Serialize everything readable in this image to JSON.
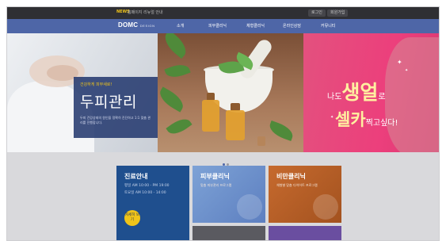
{
  "topbar": {
    "news_badge": "NEWS",
    "news_text": "홈페이지 리뉴얼 안내",
    "login_label": "로그인",
    "join_label": "회원가입"
  },
  "nav": {
    "logo": "DOMC",
    "logo_sub": "DESIGN",
    "items": [
      "소개",
      "피부클리닉",
      "체형클리닉",
      "온라인상담",
      "커뮤니티"
    ]
  },
  "hero": {
    "panel1": {
      "small": "건강하게 피부새로!",
      "big": "두피관리",
      "desc": "두피 건강상태의 원인을 정확히 진단하고 1:1 맞춤 관리를 진행합니다."
    },
    "panel3": {
      "line1_pre": "나도",
      "line1_big": "생얼",
      "line1_post": "로",
      "line2_big": "셀카",
      "line2_post": "찍고싶다!"
    }
  },
  "cards": {
    "hours": {
      "title": "진료안내",
      "line1": "평일 AM 10:00 - PM 19:00",
      "line2": "토요일 AM 10:00 - 14:00",
      "button": "자세히 보기"
    },
    "skin": {
      "title": "피부클리닉",
      "sub": "맞춤 피부관리 프로그램"
    },
    "obesity": {
      "title": "비만클리닉",
      "sub": "체형별 맞춤 다이어트 프로그램"
    }
  },
  "colors": {
    "nav": "#4e66a7",
    "topbar": "#2f2f33",
    "accent": "#f0c419",
    "hours_card": "#1f4f8e",
    "hero_pink": "#ec3f7c"
  }
}
